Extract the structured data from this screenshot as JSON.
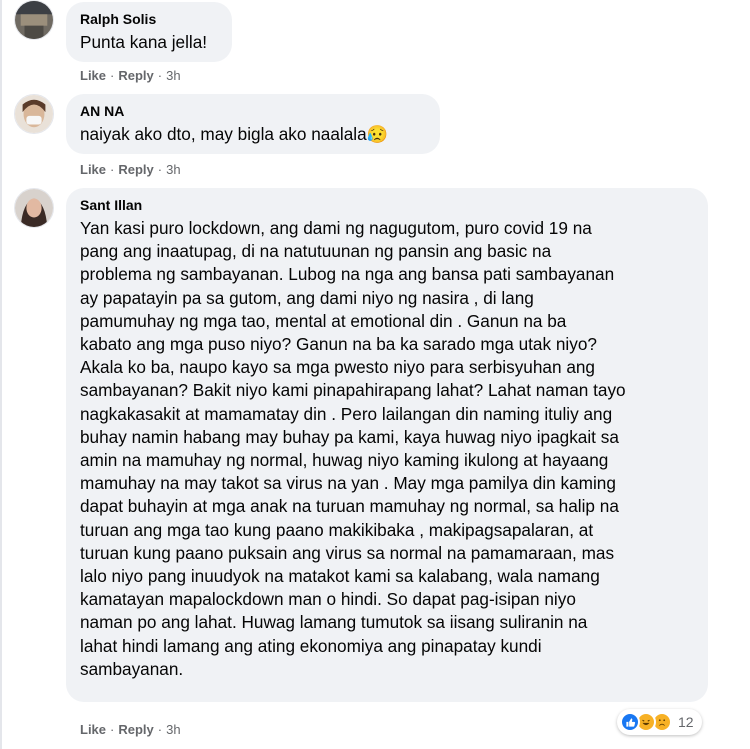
{
  "comments": [
    {
      "author": "Ralph Solis",
      "text": "Punta kana jella!",
      "like": "Like",
      "reply": "Reply",
      "time": "3h"
    },
    {
      "author": "AN NA",
      "text": "naiyak ako dto, may bigla ako naalala😥",
      "like": "Like",
      "reply": "Reply",
      "time": "3h"
    },
    {
      "author": "Sant Illan",
      "text": "Yan kasi puro lockdown, ang dami ng nagugutom, puro covid 19 na\npang ang inaatupag, di na natutuunan ng pansin ang basic na\nproblema ng sambayanan. Lubog na nga ang bansa pati sambayanan\nay papatayin pa sa gutom, ang dami niyo ng nasira , di lang\npamumuhay ng mga tao, mental at emotional din . Ganun na ba\nkabato ang mga puso niyo? Ganun na ba ka sarado mga utak niyo?\nAkala ko ba, naupo kayo sa mga pwesto niyo para serbisyuhan ang\nsambayanan? Bakit niyo kami pinapahirapang lahat? Lahat naman tayo\nnagkakasakit at mamamatay din . Pero lailangan din naming ituliy ang\nbuhay namin habang may buhay pa kami, kaya huwag niyo ipagkait sa\namin na mamuhay ng normal, huwag niyo kaming ikulong at hayaang\nmamuhay na may takot sa virus na yan . May mga pamilya din kaming\ndapat buhayin at mga anak na turuan mamuhay ng normal, sa halip na\nturuan ang mga tao kung paano makikibaka , makipagsapalaran, at\nturuan kung paano puksain ang virus sa normal na pamamaraan, mas\nlalo niyo pang inuudyok na matakot kami sa kalabang, wala namang\nkamatayan mapalockdown man o hindi. So dapat pag-isipan niyo\nnaman po ang lahat. Huwag lamang tumutok sa iisang suliranin na\nlahat hindi lamang ang ating ekonomiya ang pinapatay kundi\nsambayanan.",
      "like": "Like",
      "reply": "Reply",
      "time": "3h",
      "reactions": {
        "icons": [
          "like-reaction-icon",
          "haha-reaction-icon",
          "care-reaction-icon"
        ],
        "count": "12"
      }
    }
  ],
  "colors": {
    "bubble": "#f0f2f5",
    "meta_text": "#65676b",
    "like_blue": "#1877f2",
    "haha_yellow": "#f7b125"
  }
}
